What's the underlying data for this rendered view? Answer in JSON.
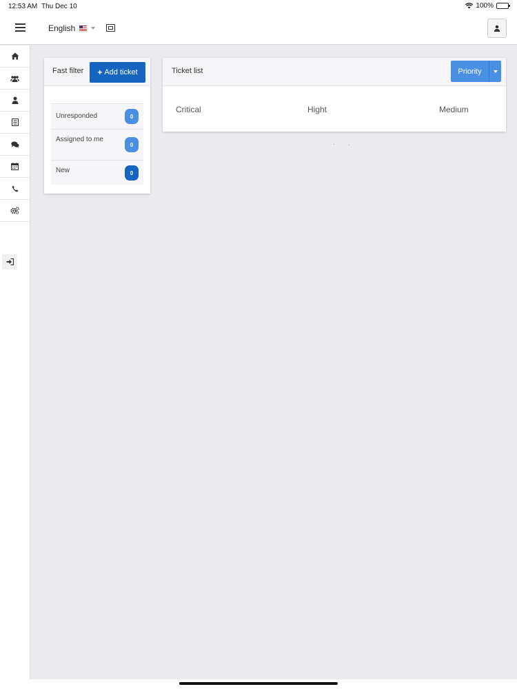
{
  "status_bar": {
    "time": "12:53 AM",
    "date": "Thu Dec 10",
    "battery": "100%"
  },
  "navbar": {
    "language": "English"
  },
  "sidebar": {
    "items": [
      {
        "icon": "home-icon"
      },
      {
        "icon": "users-icon"
      },
      {
        "icon": "user-icon"
      },
      {
        "icon": "list-icon"
      },
      {
        "icon": "chat-icon"
      },
      {
        "icon": "calendar-icon"
      },
      {
        "icon": "phone-icon"
      },
      {
        "icon": "settings-icon"
      }
    ],
    "logout_icon": "logout-icon"
  },
  "fast_filter": {
    "title": "Fast filter",
    "add_ticket_label": "Add ticket",
    "rows": [
      {
        "label": "Unresponded",
        "count": "0"
      },
      {
        "label": "Assigned to me",
        "count": "0"
      },
      {
        "label": "New",
        "count": "0"
      }
    ]
  },
  "ticket_list": {
    "title": "Ticket list",
    "priority_label": "Priority",
    "columns": [
      "Critical",
      "Hight",
      "Medium"
    ]
  },
  "colors": {
    "accent": "#1565c0",
    "badge_light": "#4a90e2",
    "badge_dark": "#1565c0",
    "priority": "#4a90e2",
    "background": "#ebeaee"
  }
}
